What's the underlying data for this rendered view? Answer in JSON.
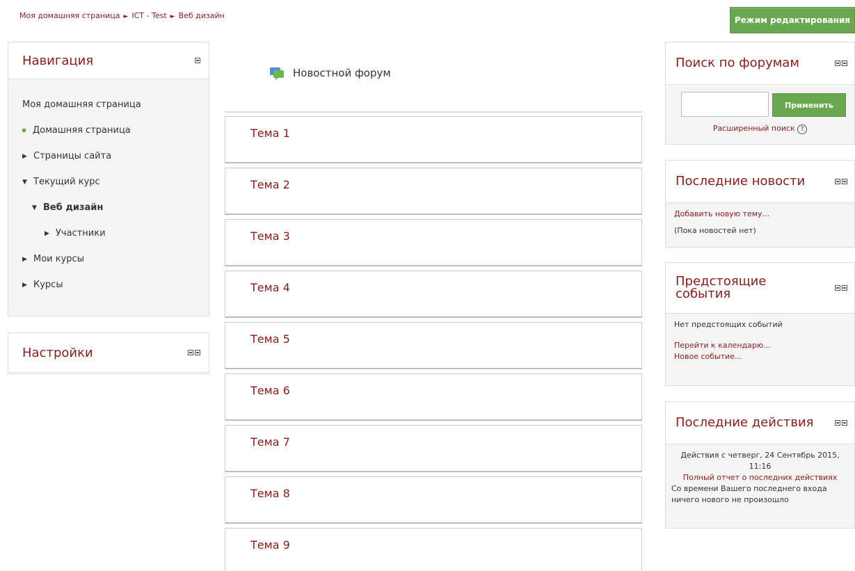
{
  "breadcrumb": {
    "items": [
      "Моя домашняя страница",
      "ICT - Test",
      "Веб дизайн"
    ]
  },
  "edit_button": "Режим редактирования",
  "navigation": {
    "title": "Навигация",
    "home": "Моя домашняя страница",
    "items": [
      {
        "label": "Домашняя страница",
        "marker": "square"
      },
      {
        "label": "Страницы сайта",
        "marker": "right"
      },
      {
        "label": "Текущий курс",
        "marker": "down"
      },
      {
        "label": "Веб дизайн",
        "marker": "down"
      },
      {
        "label": "Участники",
        "marker": "right"
      },
      {
        "label": "Мои курсы",
        "marker": "right"
      },
      {
        "label": "Курсы",
        "marker": "right"
      }
    ]
  },
  "settings": {
    "title": "Настройки"
  },
  "main": {
    "forum": "Новостной форум",
    "topics": [
      "Тема 1",
      "Тема 2",
      "Тема 3",
      "Тема 4",
      "Тема 5",
      "Тема 6",
      "Тема 7",
      "Тема 8",
      "Тема 9"
    ]
  },
  "search_forums": {
    "title": "Поиск по форумам",
    "apply": "Применить",
    "advanced": "Расширенный поиск",
    "input_value": ""
  },
  "latest_news": {
    "title": "Последние новости",
    "add": "Добавить новую тему...",
    "empty": "(Пока новостей нет)"
  },
  "upcoming": {
    "title_line1": "Предстоящие",
    "title_line2": "события",
    "none": "Нет предстоящих событий",
    "calendar": "Перейти к календарю...",
    "new_event": "Новое событие..."
  },
  "recent_activity": {
    "title": "Последние действия",
    "since_line1": "Действия с четверг, 24 Сентябрь 2015,",
    "since_line2": "11:16",
    "full_report": "Полный отчет о последних действиях",
    "nothing": "Со времени Вашего последнего входа ничего нового не произошло"
  },
  "colors": {
    "accent": "#8b1a1a",
    "button": "#6aa84f"
  }
}
